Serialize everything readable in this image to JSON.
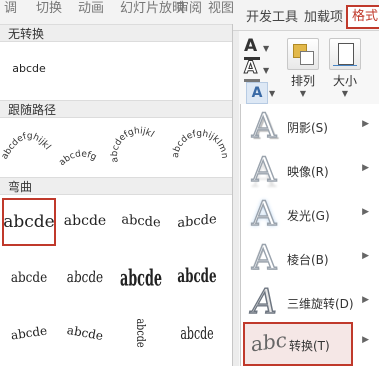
{
  "ribbon_tabs": {
    "cut_1": "调",
    "cut_2": "切换",
    "cut_3": "动画",
    "cut_4": "幻灯片放映",
    "cut_5": "审阅",
    "cut_6": "视图",
    "developer": "开发工具",
    "addins": "加载项",
    "format": "格式"
  },
  "ribbon": {
    "arrange_label": "排列",
    "size_label": "大小",
    "text_fill_color": "#333333"
  },
  "effects_menu": {
    "items": [
      {
        "label": "阴影(S)"
      },
      {
        "label": "映像(R)"
      },
      {
        "label": "发光(G)"
      },
      {
        "label": "棱台(B)"
      },
      {
        "label": "三维旋转(D)"
      },
      {
        "label": "转换(T)"
      }
    ],
    "selected_index": 5,
    "selected_icon_text": "abc"
  },
  "gallery": {
    "section_no_transform": "无转换",
    "section_follow_path": "跟随路径",
    "section_warp": "弯曲",
    "sample_text": "abcde",
    "follow_path_samples": [
      "abcdefghijkl",
      "abcdefg",
      "abcdefghijkl",
      "abcdefghijklmn"
    ]
  },
  "colors": {
    "accent_red": "#c0392b",
    "section_bg": "#eeeeee"
  }
}
